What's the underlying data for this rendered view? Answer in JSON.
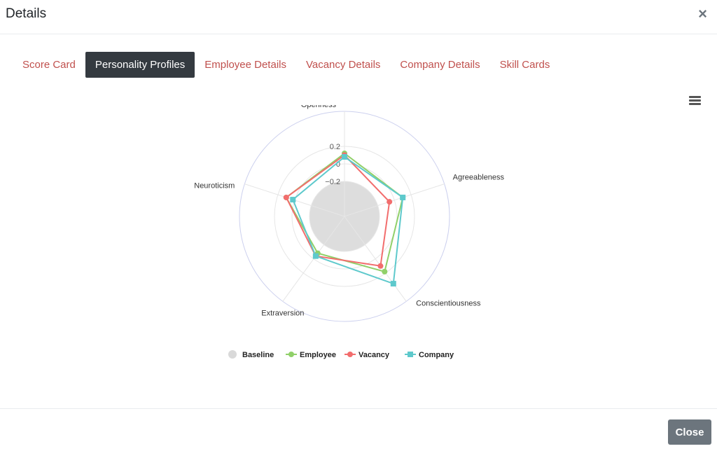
{
  "modal": {
    "title": "Details",
    "close_icon": "×",
    "close_button_label": "Close"
  },
  "tabs": [
    {
      "label": "Score Card",
      "active": false
    },
    {
      "label": "Personality Profiles",
      "active": true
    },
    {
      "label": "Employee Details",
      "active": false
    },
    {
      "label": "Vacancy Details",
      "active": false
    },
    {
      "label": "Company Details",
      "active": false
    },
    {
      "label": "Skill Cards",
      "active": false
    }
  ],
  "chart_menu_icon": "hamburger-menu-icon",
  "chart_data": {
    "type": "radar",
    "axes": [
      "Openness",
      "Agreeableness",
      "Conscientiousness",
      "Extraversion",
      "Neuroticism"
    ],
    "rlim": [
      -0.6,
      0.6
    ],
    "tick_labels": [
      "−0.2",
      "0",
      "0.2"
    ],
    "tick_values": [
      -0.2,
      0,
      0.2
    ],
    "baseline": {
      "name": "Baseline",
      "value": -0.2,
      "color": "#d9d9d9"
    },
    "series": [
      {
        "name": "Employee",
        "color": "#90d069",
        "marker": "circle",
        "values": [
          0.12,
          0.1,
          0.18,
          -0.08,
          0.1
        ]
      },
      {
        "name": "Vacancy",
        "color": "#f26d6d",
        "marker": "circle",
        "values": [
          0.1,
          -0.06,
          0.1,
          -0.04,
          0.1
        ]
      },
      {
        "name": "Company",
        "color": "#5ec9cc",
        "marker": "square",
        "values": [
          0.08,
          0.1,
          0.35,
          -0.04,
          0.02
        ]
      }
    ],
    "grid": true,
    "legend_position": "bottom"
  }
}
